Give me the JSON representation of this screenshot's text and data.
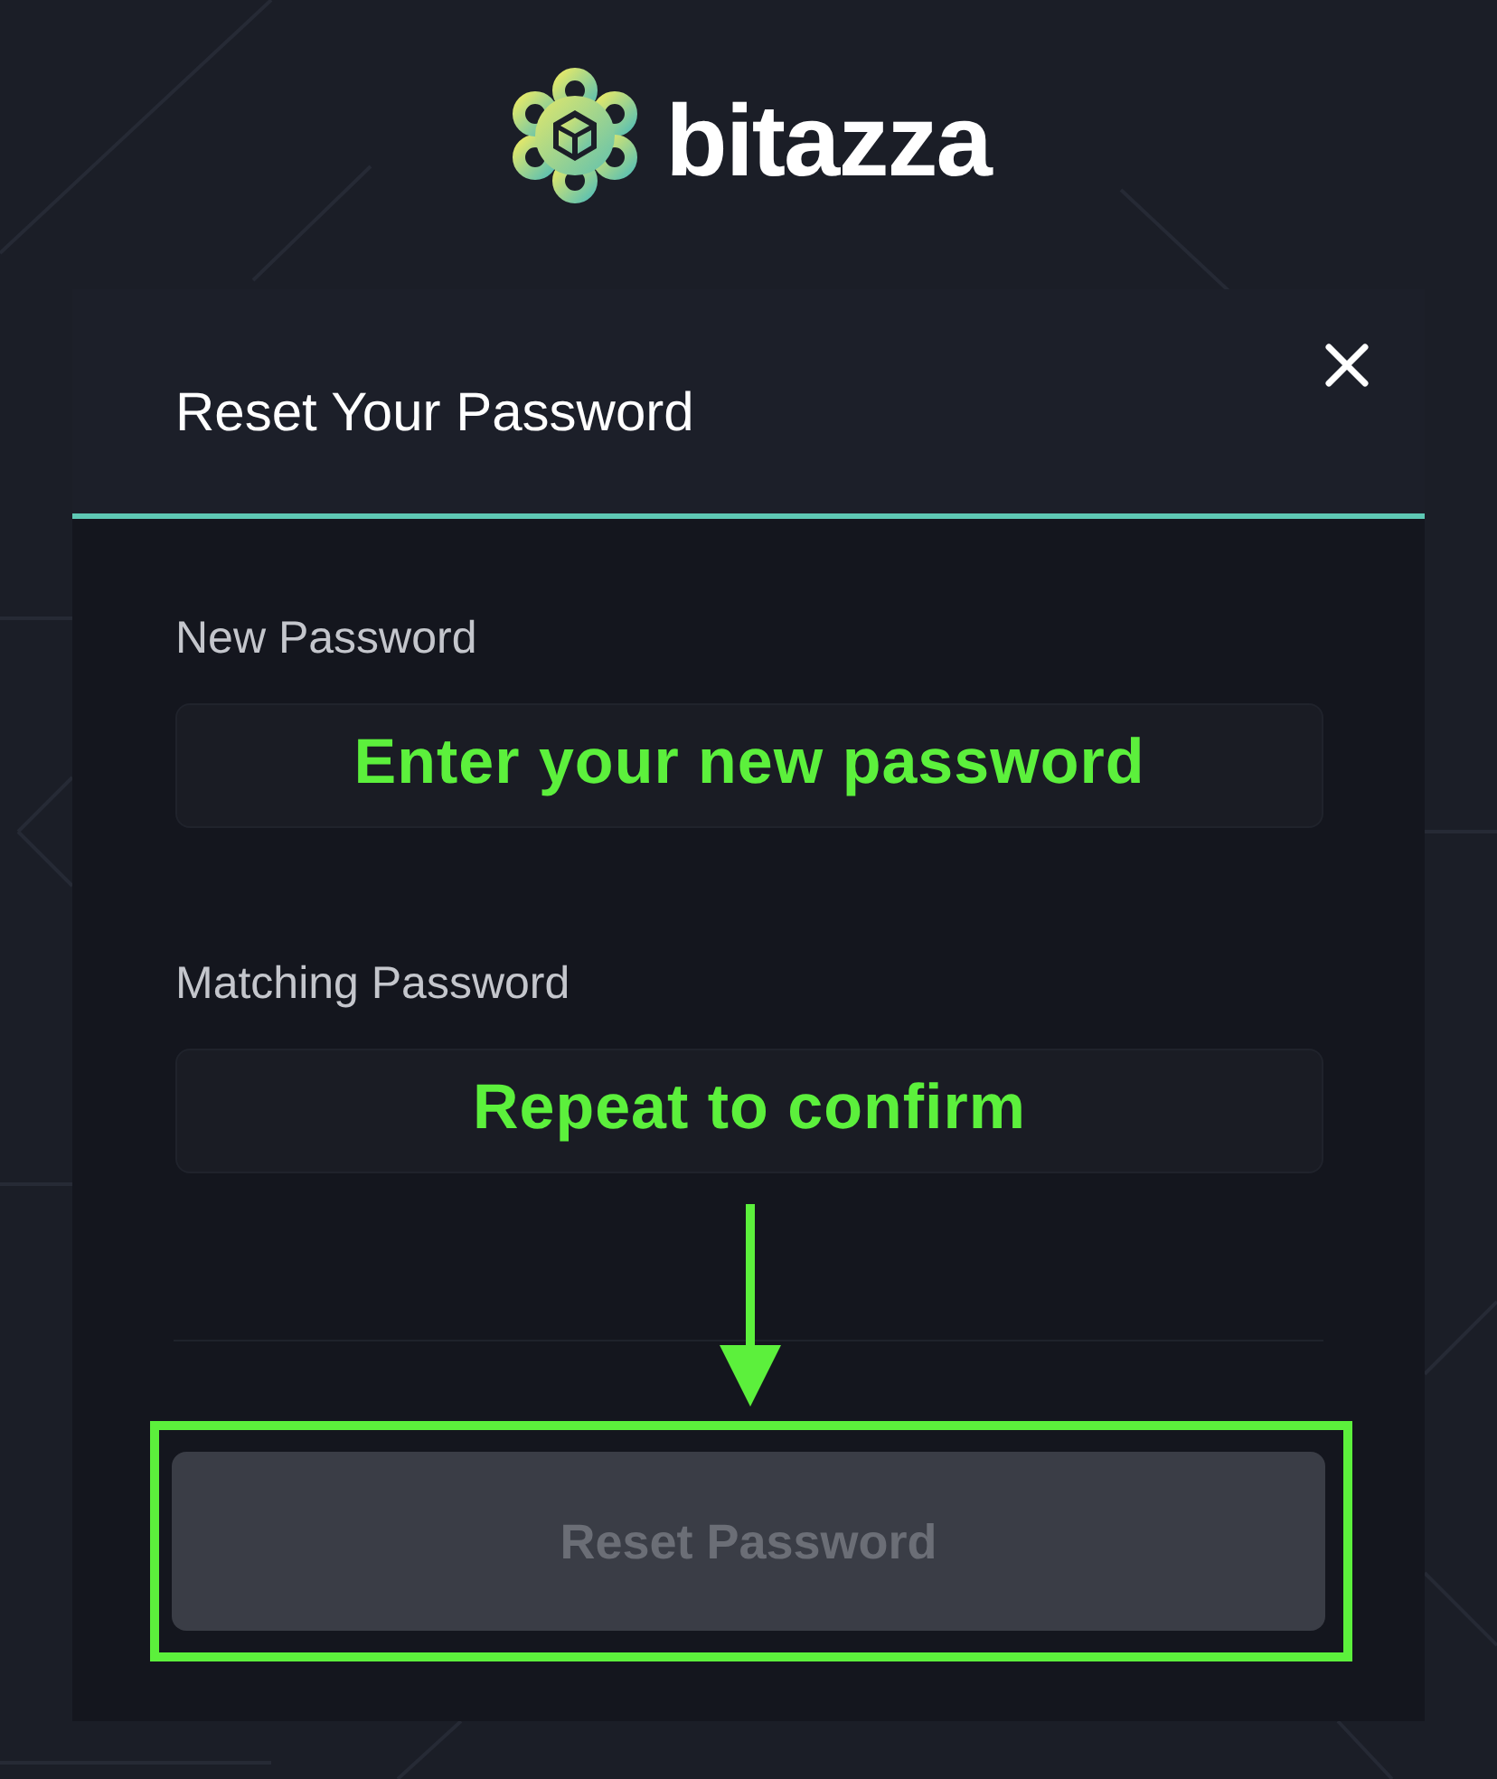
{
  "logo": {
    "text": "bitazza"
  },
  "dialog": {
    "title": "Reset Your Password",
    "close": true
  },
  "fields": [
    {
      "label": "New Password",
      "annotation": "Enter your new password"
    },
    {
      "label": "Matching Password",
      "annotation": "Repeat to confirm"
    }
  ],
  "submit": {
    "label": "Reset Password",
    "disabled": true,
    "highlighted": true
  }
}
